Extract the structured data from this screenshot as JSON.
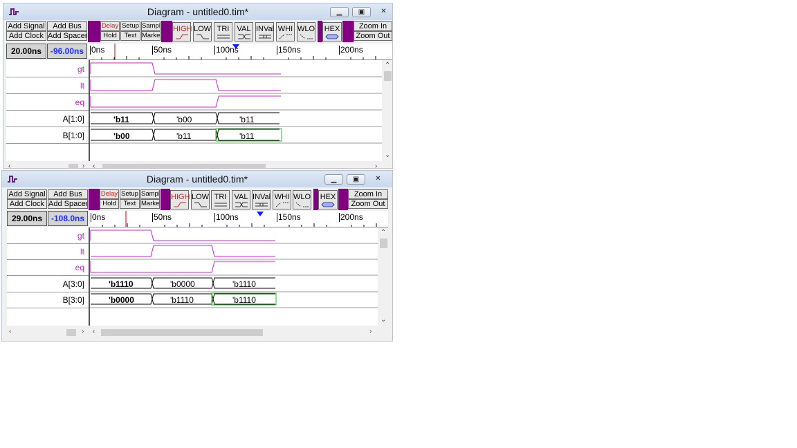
{
  "colors": {
    "signal": "#d020d0",
    "bus_text": "#000000",
    "cursor": "#e00000",
    "marker": "#1020ff",
    "active_box": "#20c020",
    "toolbar_purple": "#800080"
  },
  "toolbar": {
    "add_signal": "Add Signal",
    "add_bus": "Add Bus",
    "add_clock": "Add Clock",
    "add_spacer": "Add Spacer",
    "delay": "Delay",
    "setup": "Setup",
    "sample": "Sample",
    "hold": "Hold",
    "text": "Text",
    "marker": "Marker",
    "high": "HIGH",
    "low": "LOW",
    "tri": "TRI",
    "val": "VAL",
    "inval": "INVal",
    "whi": "WHI",
    "wlo": "WLO",
    "hex": "HEX",
    "zoom_in": "Zoom In",
    "zoom_out": "Zoom Out"
  },
  "windows": [
    {
      "title": "Diagram - untitled0.tim*",
      "time_cursor": "20.00ns",
      "time_delta": "-96.00ns",
      "ruler": [
        "0ns",
        "50ns",
        "100ns",
        "150ns",
        "200ns"
      ],
      "signals": [
        {
          "name": "gt",
          "type": "signal",
          "levels": [
            "high",
            "low",
            "low"
          ]
        },
        {
          "name": "lt",
          "type": "signal",
          "levels": [
            "low",
            "high",
            "low"
          ]
        },
        {
          "name": "eq",
          "type": "signal",
          "levels": [
            "low",
            "low",
            "high"
          ]
        },
        {
          "name": "A[1:0]",
          "type": "bus",
          "values": [
            "'b11",
            "'b00",
            "'b11"
          ]
        },
        {
          "name": "B[1:0]",
          "type": "bus",
          "values": [
            "'b00",
            "'b11",
            "'b11"
          ]
        }
      ]
    },
    {
      "title": "Diagram - untitled0.tim*",
      "time_cursor": "29.00ns",
      "time_delta": "-108.0ns",
      "ruler": [
        "0ns",
        "50ns",
        "100ns",
        "150ns",
        "200ns"
      ],
      "signals": [
        {
          "name": "gt",
          "type": "signal",
          "levels": [
            "high",
            "low",
            "low"
          ]
        },
        {
          "name": "lt",
          "type": "signal",
          "levels": [
            "low",
            "high",
            "low"
          ]
        },
        {
          "name": "eq",
          "type": "signal",
          "levels": [
            "low",
            "low",
            "high"
          ]
        },
        {
          "name": "A[3:0]",
          "type": "bus",
          "values": [
            "'b1110",
            "'b0000",
            "'b1110"
          ]
        },
        {
          "name": "B[3:0]",
          "type": "bus",
          "values": [
            "'b0000",
            "'b1110",
            "'b1110"
          ]
        }
      ]
    }
  ]
}
